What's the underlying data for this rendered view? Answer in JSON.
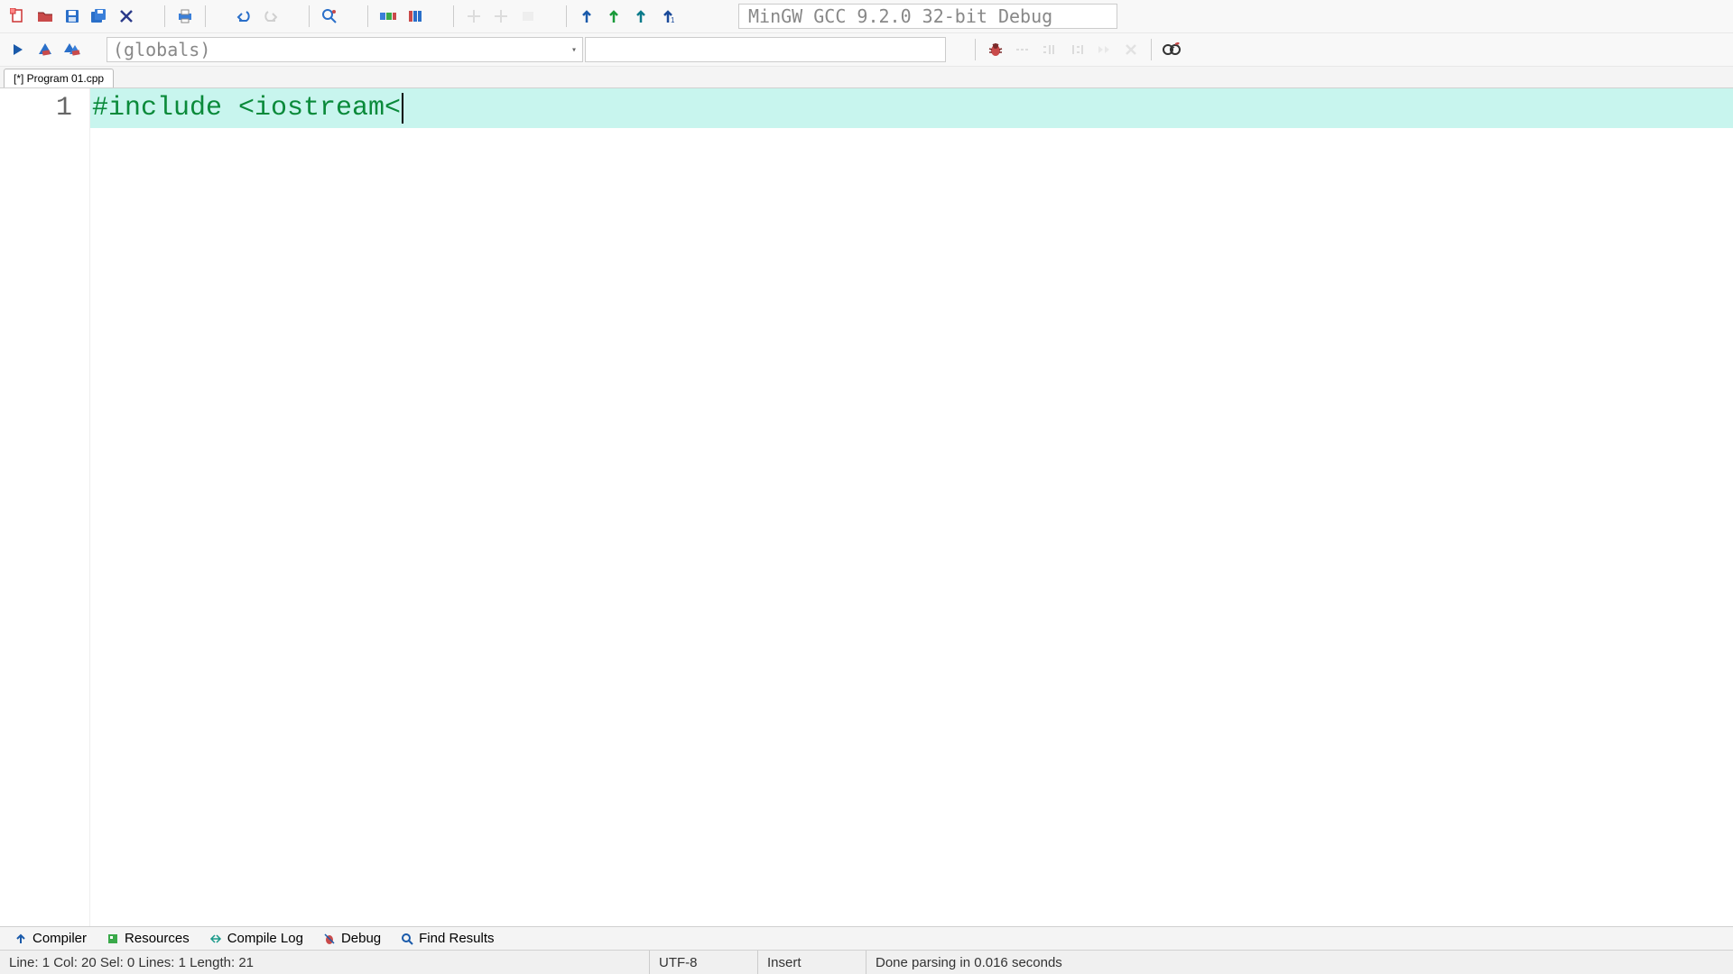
{
  "toolbar": {
    "compiler_label": "MinGW GCC 9.2.0 32-bit Debug"
  },
  "scope": {
    "selected": "(globals)"
  },
  "tabs": {
    "active": "[*] Program 01.cpp"
  },
  "editor": {
    "lines": [
      {
        "n": "1",
        "text": "#include <iostream<",
        "klass": "tok-pre"
      }
    ]
  },
  "bottom_tabs": {
    "compiler": "Compiler",
    "resources": "Resources",
    "compile_log": "Compile Log",
    "debug": "Debug",
    "find_results": "Find Results"
  },
  "status": {
    "pos": "Line:    1    Col:    20    Sel:    0    Lines:    1    Length:    21",
    "encoding": "UTF-8",
    "mode": "Insert",
    "message": "Done parsing in 0.016 seconds"
  }
}
